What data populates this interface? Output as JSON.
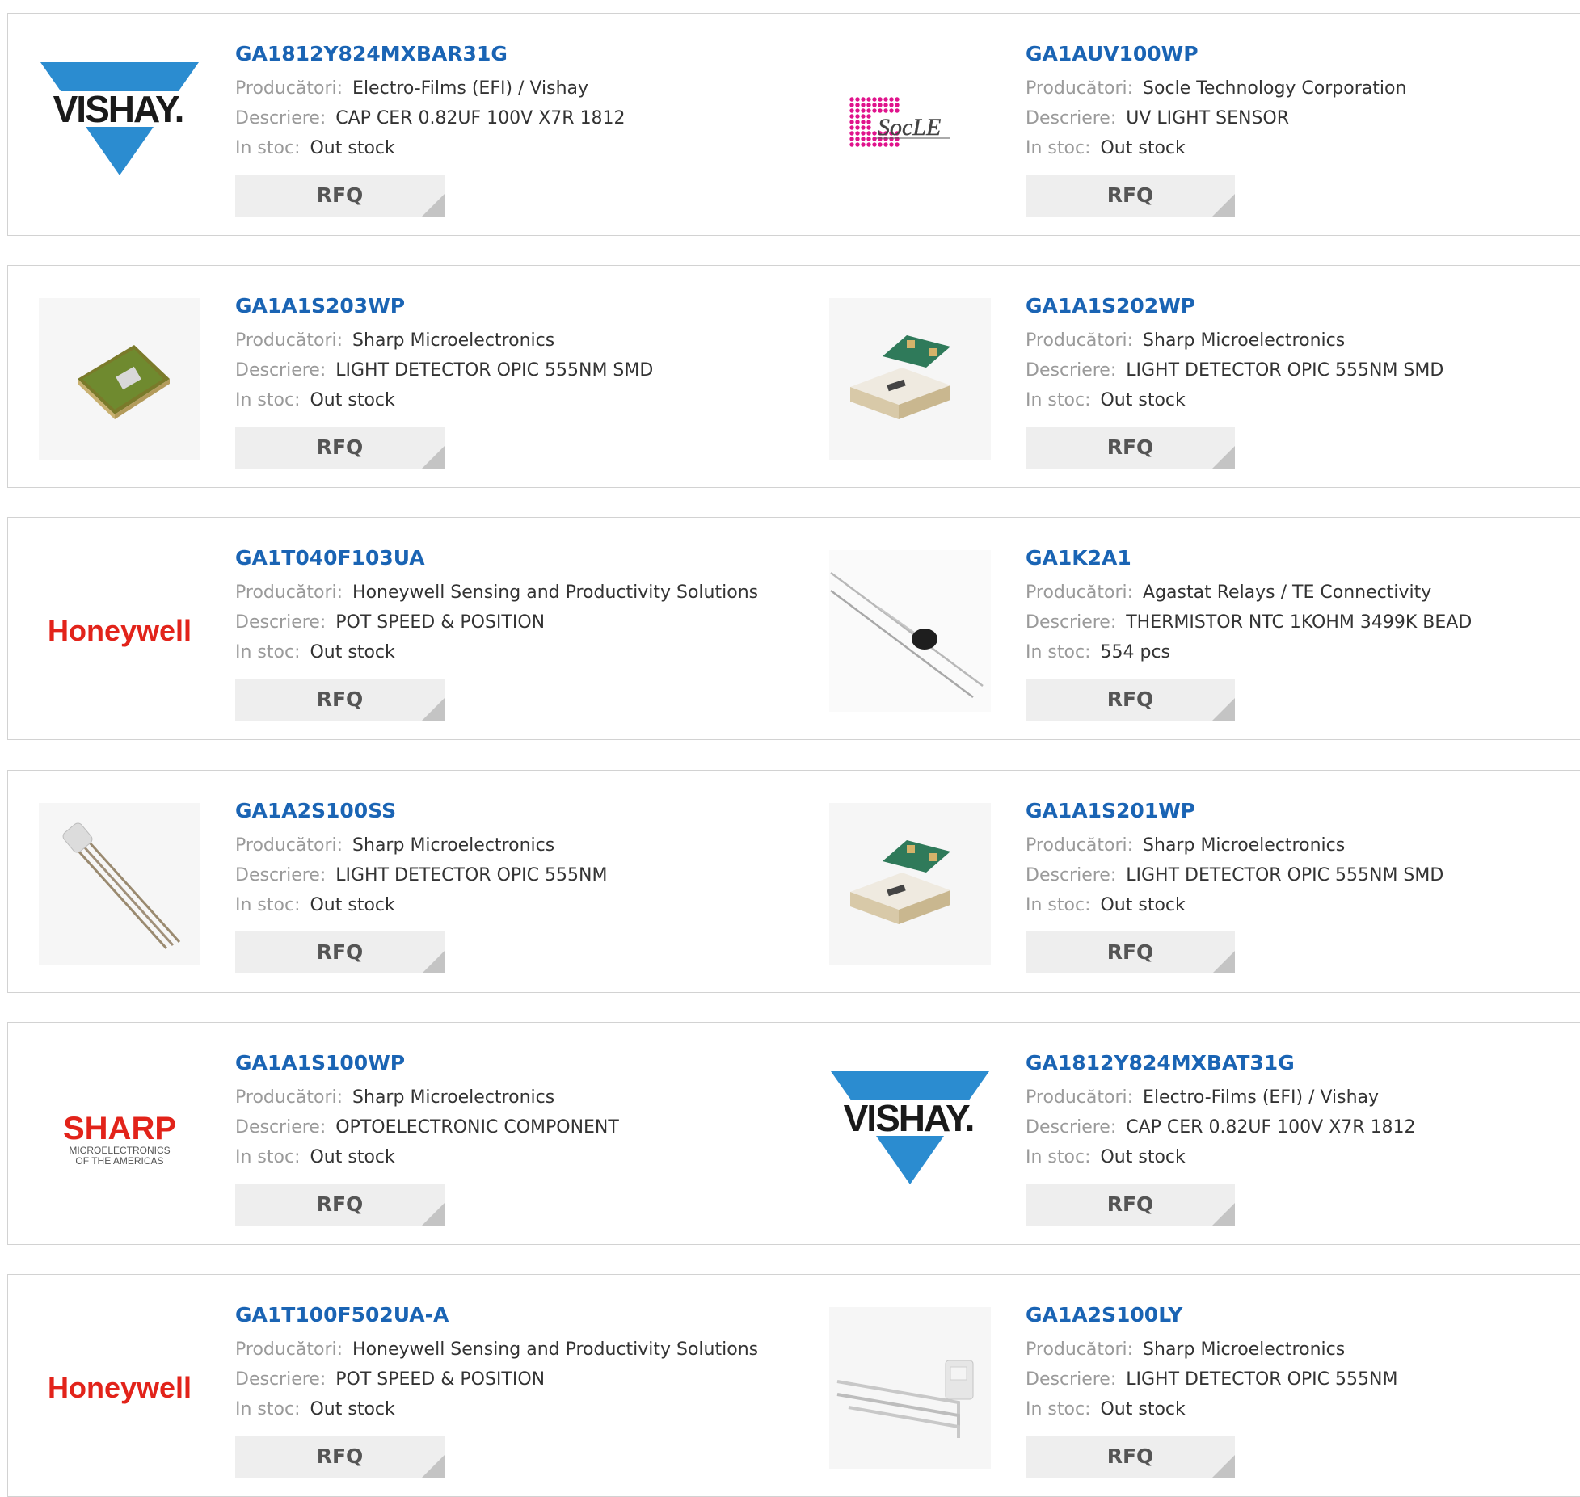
{
  "labels": {
    "manufacturer": "Producători:",
    "description": "Descriere:",
    "stock": "In stoc:"
  },
  "rows": [
    {
      "left": {
        "part": "GA1812Y824MXBAR31G",
        "manufacturer": "Electro-Films (EFI) / Vishay",
        "description": "CAP CER 0.82UF 100V X7R 1812",
        "stock": "Out stock",
        "button": "RFQ",
        "image": "vishay-logo",
        "logo_text": "VISHAY."
      },
      "right": {
        "part": "GA1AUV100WP",
        "manufacturer": "Socle Technology Corporation",
        "description": "UV LIGHT SENSOR",
        "stock": "Out stock",
        "button": "RFQ",
        "image": "socle-logo",
        "logo_text": "SocLE"
      }
    },
    {
      "left": {
        "part": "GA1A1S203WP",
        "manufacturer": "Sharp Microelectronics",
        "description": "LIGHT DETECTOR OPIC 555NM SMD",
        "stock": "Out stock",
        "button": "RFQ",
        "image": "smd-sensor-photo"
      },
      "right": {
        "part": "GA1A1S202WP",
        "manufacturer": "Sharp Microelectronics",
        "description": "LIGHT DETECTOR OPIC 555NM SMD",
        "stock": "Out stock",
        "button": "RFQ",
        "image": "smd-sensor-pair-photo"
      }
    },
    {
      "left": {
        "part": "GA1T040F103UA",
        "manufacturer": "Honeywell Sensing and Productivity Solutions",
        "description": "POT SPEED & POSITION",
        "stock": "Out stock",
        "button": "RFQ",
        "image": "honeywell-logo",
        "logo_text": "Honeywell"
      },
      "right": {
        "part": "GA1K2A1",
        "manufacturer": "Agastat Relays / TE Connectivity",
        "description": "THERMISTOR NTC 1KOHM 3499K BEAD",
        "stock": "554 pcs",
        "button": "RFQ",
        "image": "thermistor-photo"
      }
    },
    {
      "left": {
        "part": "GA1A2S100SS",
        "manufacturer": "Sharp Microelectronics",
        "description": "LIGHT DETECTOR OPIC 555NM",
        "stock": "Out stock",
        "button": "RFQ",
        "image": "through-hole-sensor-photo"
      },
      "right": {
        "part": "GA1A1S201WP",
        "manufacturer": "Sharp Microelectronics",
        "description": "LIGHT DETECTOR OPIC 555NM SMD",
        "stock": "Out stock",
        "button": "RFQ",
        "image": "smd-sensor-pair-photo"
      }
    },
    {
      "left": {
        "part": "GA1A1S100WP",
        "manufacturer": "Sharp Microelectronics",
        "description": "OPTOELECTRONIC COMPONENT",
        "stock": "Out stock",
        "button": "RFQ",
        "image": "sharp-logo",
        "logo_text": "SHARP",
        "logo_sub1": "MICROELECTRONICS",
        "logo_sub2": "OF THE AMERICAS"
      },
      "right": {
        "part": "GA1812Y824MXBAT31G",
        "manufacturer": "Electro-Films (EFI) / Vishay",
        "description": "CAP CER 0.82UF 100V X7R 1812",
        "stock": "Out stock",
        "button": "RFQ",
        "image": "vishay-logo",
        "logo_text": "VISHAY."
      }
    },
    {
      "left": {
        "part": "GA1T100F502UA-A",
        "manufacturer": "Honeywell Sensing and Productivity Solutions",
        "description": "POT SPEED & POSITION",
        "stock": "Out stock",
        "button": "RFQ",
        "image": "honeywell-logo",
        "logo_text": "Honeywell"
      },
      "right": {
        "part": "GA1A2S100LY",
        "manufacturer": "Sharp Microelectronics",
        "description": "LIGHT DETECTOR OPIC 555NM",
        "stock": "Out stock",
        "button": "RFQ",
        "image": "bent-lead-sensor-photo"
      }
    }
  ]
}
